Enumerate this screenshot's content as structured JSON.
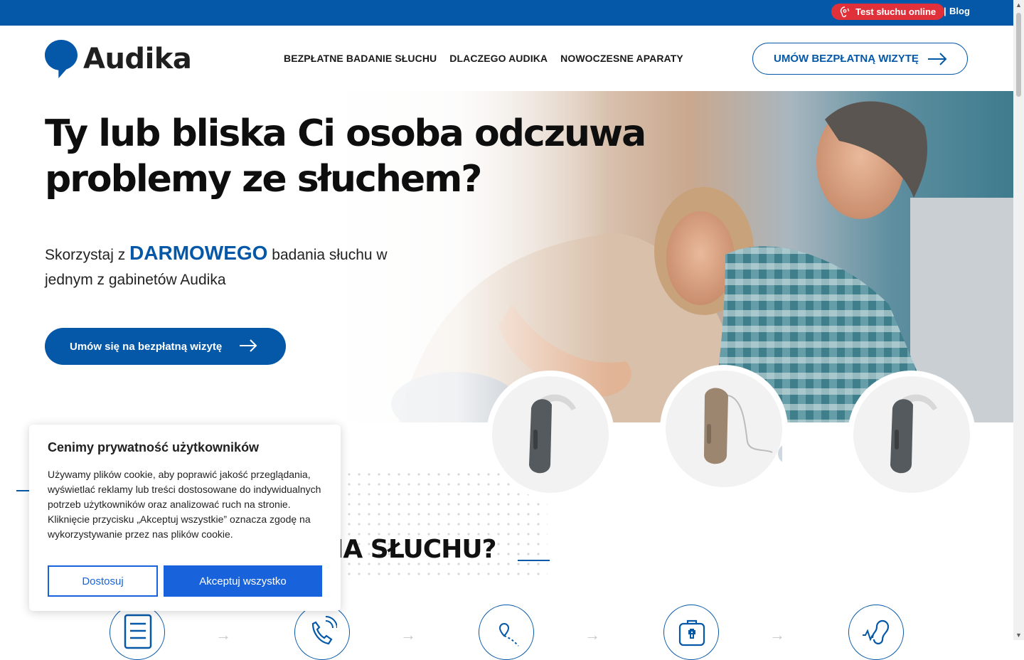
{
  "topbar": {
    "test_label": "Test słuchu online",
    "separator": "|",
    "blog_label": "Blog"
  },
  "header": {
    "logo_text": "Audika",
    "nav": [
      "BEZPŁATNE BADANIE SŁUCHU",
      "DLACZEGO AUDIKA",
      "NOWOCZESNE APARATY"
    ],
    "cta_label": "UMÓW BEZPŁATNĄ WIZYTĘ"
  },
  "hero": {
    "title_line1": "Ty lub bliska Ci osoba odczuwa",
    "title_line2": "problemy ze słuchem?",
    "text_before": "Skorzystaj z ",
    "text_highlight": "DARMOWEGO",
    "text_after": " badania słuchu w jednym z gabinetów Audika",
    "button_label": "Umów się na bezpłatną wizytę"
  },
  "section": {
    "title_visible": "IA SŁUCHU?"
  },
  "steps": [
    {
      "icon": "form-icon"
    },
    {
      "icon": "phone-call-icon"
    },
    {
      "icon": "map-route-icon"
    },
    {
      "icon": "medical-kit-icon"
    },
    {
      "icon": "ear-icon"
    }
  ],
  "cookie": {
    "title": "Cenimy prywatność użytkowników",
    "text": "Używamy plików cookie, aby poprawić jakość przeglądania, wyświetlać reklamy lub treści dostosowane do indywidualnych potrzeb użytkowników oraz analizować ruch na stronie. Kliknięcie przycisku „Akceptuj wszystkie” oznacza zgodę na wykorzystywanie przez nas plików cookie.",
    "customize_label": "Dostosuj",
    "accept_label": "Akceptuj wszystko"
  },
  "colors": {
    "brand_blue": "#0558a8",
    "test_red": "#e0313a",
    "cookie_blue": "#1863dc"
  }
}
